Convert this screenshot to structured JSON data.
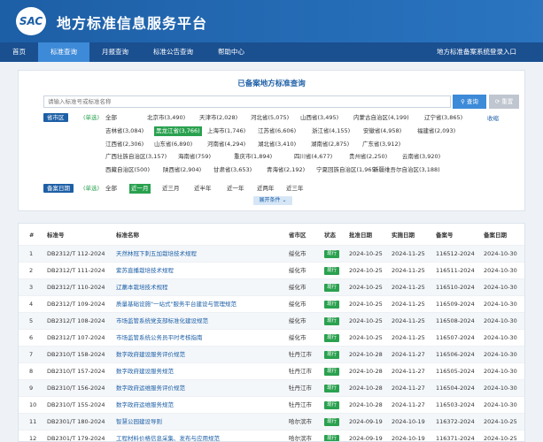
{
  "header": {
    "logo_text": "SAC",
    "title": "地方标准信息服务平台"
  },
  "nav": {
    "items": [
      "首页",
      "标准查询",
      "月报查询",
      "标准公告查询",
      "帮助中心"
    ],
    "active": 1,
    "login": "地方标准备案系统登录入口"
  },
  "search": {
    "title": "已备案地方标准查询",
    "placeholder": "请输入标准号或标准名称",
    "search_btn": "查询",
    "reset_btn": "重置"
  },
  "filters": {
    "province_label": "省市区",
    "single": "(单选)",
    "collapse": "收缩",
    "provinces": [
      [
        "全部",
        "北京市(3,490)",
        "天津市(2,028)",
        "河北省(5,075)",
        "山西省(3,495)",
        "内蒙古自治区(4,199)",
        "辽宁省(3,865)"
      ],
      [
        "吉林省(3,084)",
        "黑龙江省(3,766)",
        "上海市(1,746)",
        "江苏省(6,606)",
        "浙江省(4,155)",
        "安徽省(4,958)",
        "福建省(2,093)"
      ],
      [
        "江西省(2,306)",
        "山东省(6,890)",
        "河南省(4,294)",
        "湖北省(3,410)",
        "湖南省(2,875)",
        "广东省(3,912)"
      ],
      [
        "广西壮族自治区(3,157)",
        "海南省(759)",
        "重庆市(1,894)",
        "四川省(4,677)",
        "贵州省(2,250)",
        "云南省(3,920)"
      ],
      [
        "西藏自治区(500)",
        "陕西省(2,904)",
        "甘肃省(3,653)",
        "青海省(2,192)",
        "宁夏回族自治区(1,965)",
        "新疆维吾尔自治区(3,188)"
      ]
    ],
    "date_label": "备案日期",
    "dates": [
      "全部",
      "近一月",
      "近三月",
      "近半年",
      "近一年",
      "近两年",
      "近三年"
    ],
    "expand": "展开条件"
  },
  "table": {
    "headers": [
      "#",
      "标准号",
      "标准名称",
      "省市区",
      "状态",
      "批准日期",
      "实施日期",
      "备案号",
      "备案日期"
    ],
    "rows": [
      [
        "1",
        "DB2312/T 112-2024",
        "天然林冠下刺五加栽培技术规程",
        "绥化市",
        "现行",
        "2024-10-25",
        "2024-11-25",
        "116512-2024",
        "2024-10-30"
      ],
      [
        "2",
        "DB2312/T 111-2024",
        "紫苏直播栽培技术规程",
        "绥化市",
        "现行",
        "2024-10-25",
        "2024-11-25",
        "116511-2024",
        "2024-10-30"
      ],
      [
        "3",
        "DB2312/T 110-2024",
        "辽藁本栽培技术规程",
        "绥化市",
        "现行",
        "2024-10-25",
        "2024-11-25",
        "116510-2024",
        "2024-10-30"
      ],
      [
        "4",
        "DB2312/T 109-2024",
        "质量基础设施\"一站式\"服务平台建设与管理规范",
        "绥化市",
        "现行",
        "2024-10-25",
        "2024-11-25",
        "116509-2024",
        "2024-10-30"
      ],
      [
        "5",
        "DB2312/T 108-2024",
        "市场监管系统党支部标准化建设规范",
        "绥化市",
        "现行",
        "2024-10-25",
        "2024-11-25",
        "116508-2024",
        "2024-10-30"
      ],
      [
        "6",
        "DB2312/T 107-2024",
        "市场监管系统公务员平时考核指南",
        "绥化市",
        "现行",
        "2024-10-25",
        "2024-11-25",
        "116507-2024",
        "2024-10-30"
      ],
      [
        "7",
        "DB2310/T 158-2024",
        "数字政府建设服务评价规范",
        "牡丹江市",
        "现行",
        "2024-10-28",
        "2024-11-27",
        "116506-2024",
        "2024-10-30"
      ],
      [
        "8",
        "DB2310/T 157-2024",
        "数字政府建设服务规范",
        "牡丹江市",
        "现行",
        "2024-10-28",
        "2024-11-27",
        "116505-2024",
        "2024-10-30"
      ],
      [
        "9",
        "DB2310/T 156-2024",
        "数字政府运维服务评价规范",
        "牡丹江市",
        "现行",
        "2024-10-28",
        "2024-11-27",
        "116504-2024",
        "2024-10-30"
      ],
      [
        "10",
        "DB2310/T 155-2024",
        "数字政府运维服务规范",
        "牡丹江市",
        "现行",
        "2024-10-28",
        "2024-11-27",
        "116503-2024",
        "2024-10-30"
      ],
      [
        "11",
        "DB2301/T 180-2024",
        "智慧公园建设导则",
        "哈尔滨市",
        "现行",
        "2024-09-19",
        "2024-10-19",
        "116372-2024",
        "2024-10-25"
      ],
      [
        "12",
        "DB2301/T 179-2024",
        "工程材料价格信息采集、发布与应用规范",
        "哈尔滨市",
        "现行",
        "2024-09-19",
        "2024-10-19",
        "116371-2024",
        "2024-10-25"
      ]
    ]
  }
}
